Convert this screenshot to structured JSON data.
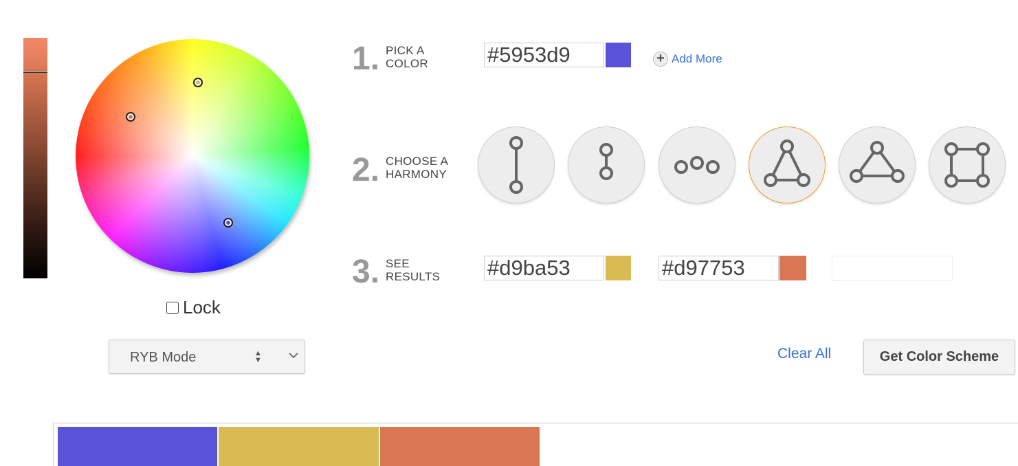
{
  "picker": {
    "lock_label": "Lock",
    "mode_select": {
      "value": "RYB Mode"
    }
  },
  "steps": {
    "pick": {
      "number": "1",
      "title_line1": "PICK A",
      "title_line2": "COLOR",
      "hex": "#5953d9",
      "swatch_color": "#5953d9",
      "add_more_label": "Add More"
    },
    "harmony": {
      "number": "2",
      "title_line1": "CHOOSE A",
      "title_line2": "HARMONY",
      "selected_index": 4,
      "options": [
        "complementary-icon",
        "split-complementary-icon",
        "analogous-icon",
        "triad-icon",
        "triad-wide-icon",
        "tetrad-icon"
      ]
    },
    "results": {
      "number": "3",
      "title_line1": "SEE",
      "title_line2": "RESULTS",
      "colors": [
        {
          "hex": "#d9ba53",
          "swatch_color": "#d9ba53"
        },
        {
          "hex": "#d97753",
          "swatch_color": "#d97753"
        }
      ]
    }
  },
  "actions": {
    "clear_all_label": "Clear All",
    "get_scheme_label": "Get Color Scheme"
  },
  "palette": [
    "#5953d9",
    "#d9ba53",
    "#d97753"
  ],
  "colors": {
    "accent_link": "#3a6fd8",
    "selected_border": "#f0a030"
  }
}
